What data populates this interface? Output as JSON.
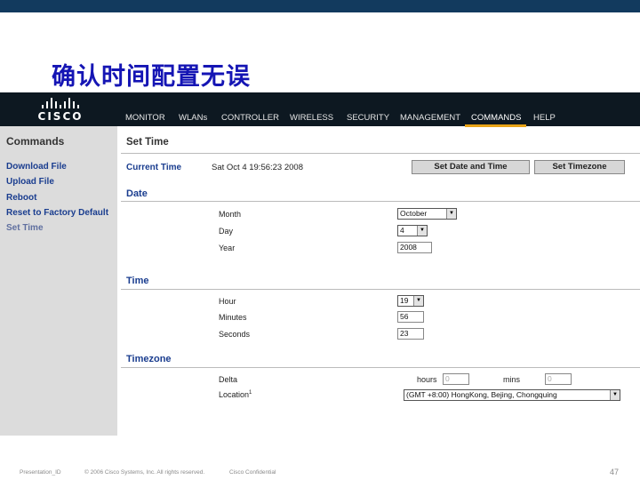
{
  "slide": {
    "title": "确认时间配置无误",
    "footer_left": "Presentation_ID",
    "footer_copyright": "© 2006 Cisco Systems, Inc. All rights reserved.",
    "footer_conf": "Cisco Confidential",
    "page_number": "47"
  },
  "colors": {
    "title": "#1515b4",
    "nav_bg": "#0d1821",
    "accent": "#e8a317",
    "link": "#1a3d8f"
  },
  "nav": {
    "logo": "CISCO",
    "items": [
      "MONITOR",
      "WLANs",
      "CONTROLLER",
      "WIRELESS",
      "SECURITY",
      "MANAGEMENT",
      "COMMANDS",
      "HELP"
    ],
    "active": "COMMANDS"
  },
  "sidebar": {
    "heading": "Commands",
    "items": [
      "Download File",
      "Upload File",
      "Reboot",
      "Reset to Factory Default",
      "Set Time"
    ]
  },
  "page": {
    "title": "Set Time",
    "current_time_label": "Current Time",
    "current_time_value": "Sat Oct 4 19:56:23 2008",
    "set_date_button": "Set Date and Time",
    "set_timezone_button": "Set Timezone",
    "date_section": "Date",
    "month_label": "Month",
    "month_value": "October",
    "day_label": "Day",
    "day_value": "4",
    "year_label": "Year",
    "year_value": "2008",
    "time_section": "Time",
    "hour_label": "Hour",
    "hour_value": "19",
    "minutes_label": "Minutes",
    "minutes_value": "56",
    "seconds_label": "Seconds",
    "seconds_value": "23",
    "timezone_section": "Timezone",
    "delta_label": "Delta",
    "hours_label": "hours",
    "hours_value": "0",
    "mins_label": "mins",
    "mins_value": "0",
    "location_label": "Location",
    "location_marker": "1",
    "location_value": "(GMT +8:00) HongKong, Bejing, Chongquing"
  }
}
